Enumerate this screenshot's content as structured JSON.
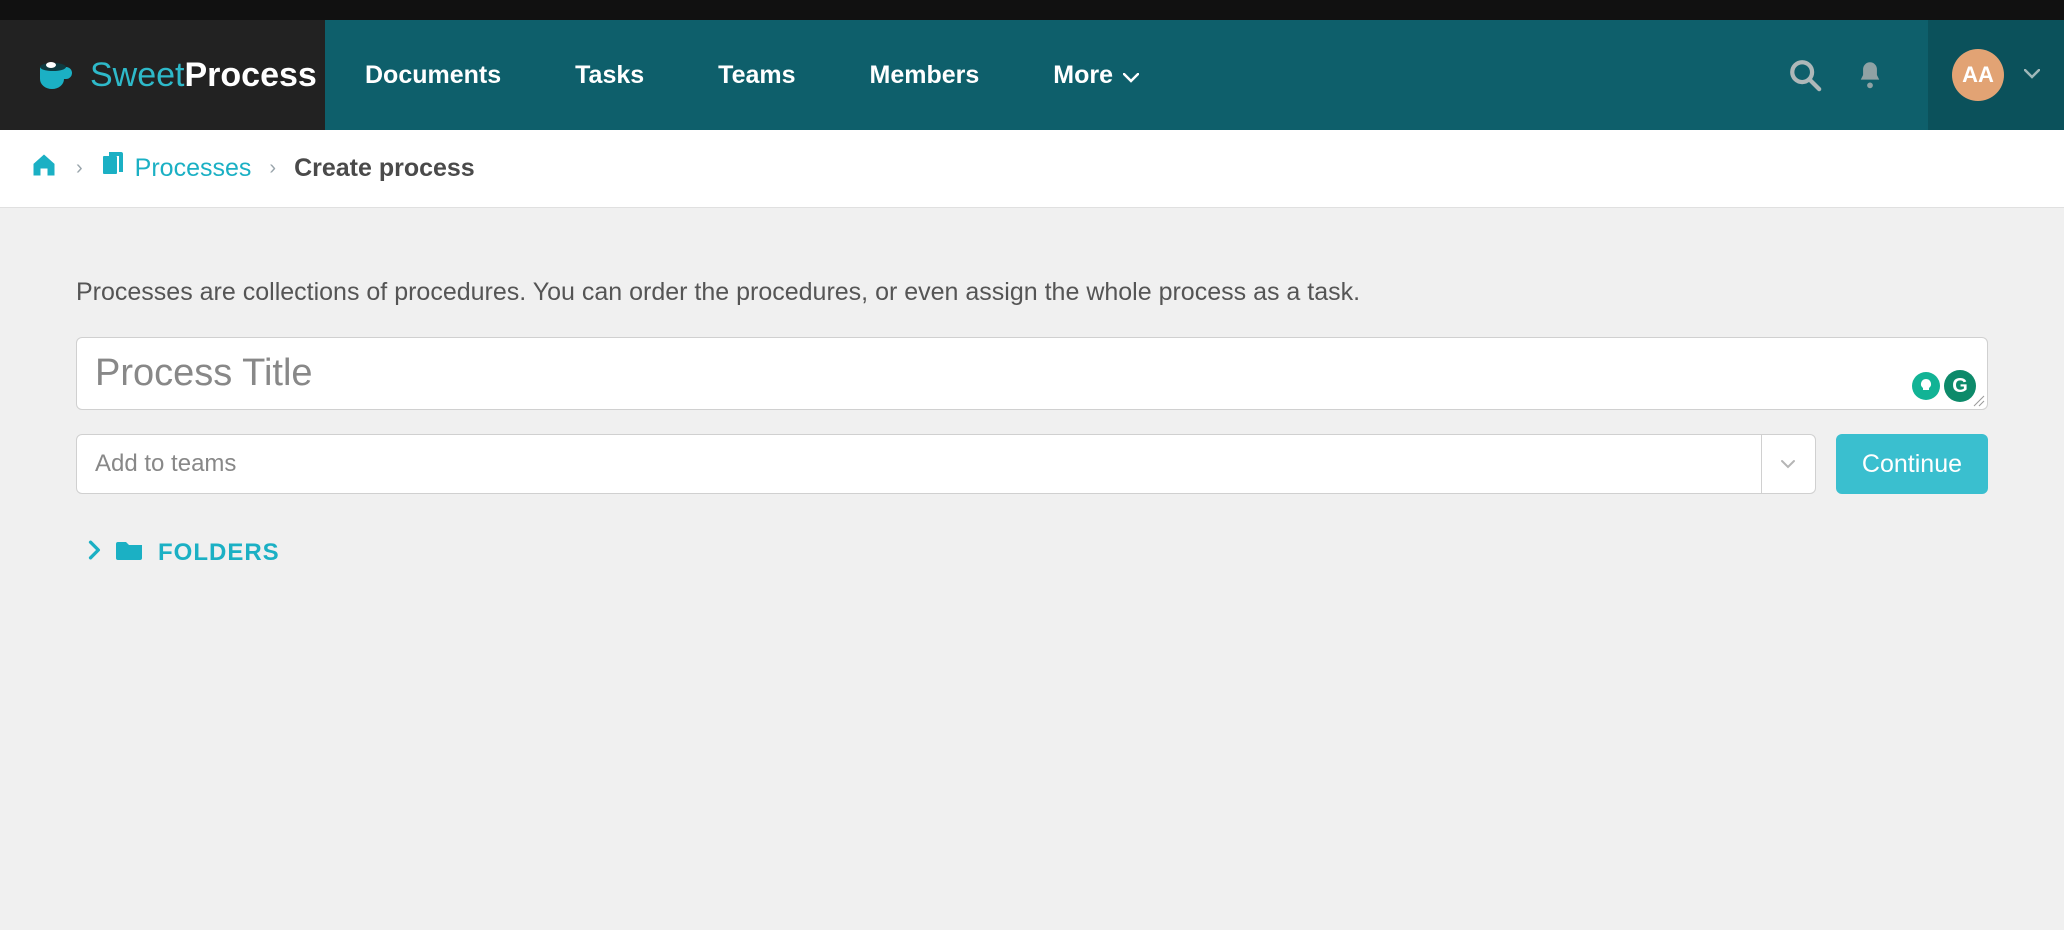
{
  "brand": {
    "name_part1": "Sweet",
    "name_part2": "Process"
  },
  "nav": {
    "items": [
      "Documents",
      "Tasks",
      "Teams",
      "Members",
      "More"
    ]
  },
  "user": {
    "initials": "AA"
  },
  "breadcrumb": {
    "link_label": "Processes",
    "current": "Create process",
    "separator": "›"
  },
  "content": {
    "description": "Processes are collections of procedures. You can order the procedures, or even assign the whole process as a task.",
    "title_placeholder": "Process Title",
    "teams_placeholder": "Add to teams",
    "continue_label": "Continue",
    "folders_label": "FOLDERS"
  },
  "grammarly": {
    "badge_letter": "G"
  }
}
